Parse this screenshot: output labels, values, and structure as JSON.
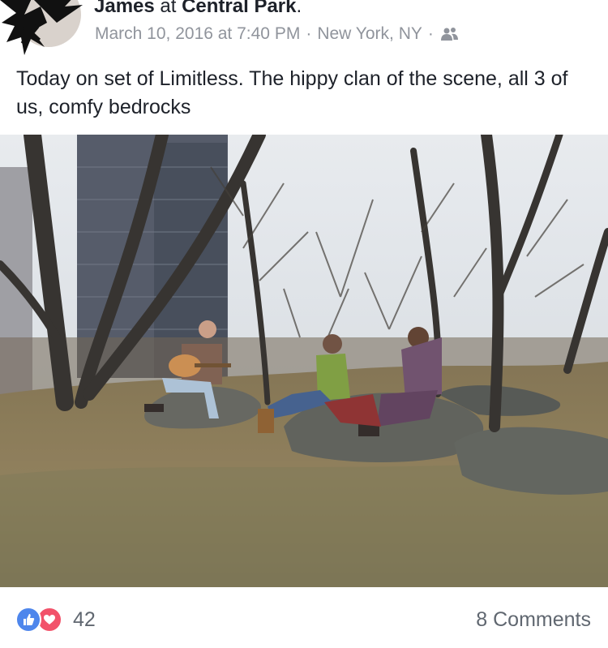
{
  "post": {
    "author": "James",
    "at_word": "at",
    "place": "Central Park",
    "period": ".",
    "date": "March 10, 2016 at 7:40 PM",
    "separator": "·",
    "location": "New York, NY",
    "audience_icon": "friends-icon",
    "text": "Today on set of Limitless. The hippy clan of the scene, all 3 of us, comfy bedrocks"
  },
  "footer": {
    "reaction_icons": [
      "like-icon",
      "love-icon"
    ],
    "reaction_count": "42",
    "comments_label": "8 Comments"
  },
  "colors": {
    "like": "#4e86ec",
    "love": "#f2526a",
    "meta_text": "#90949c"
  }
}
